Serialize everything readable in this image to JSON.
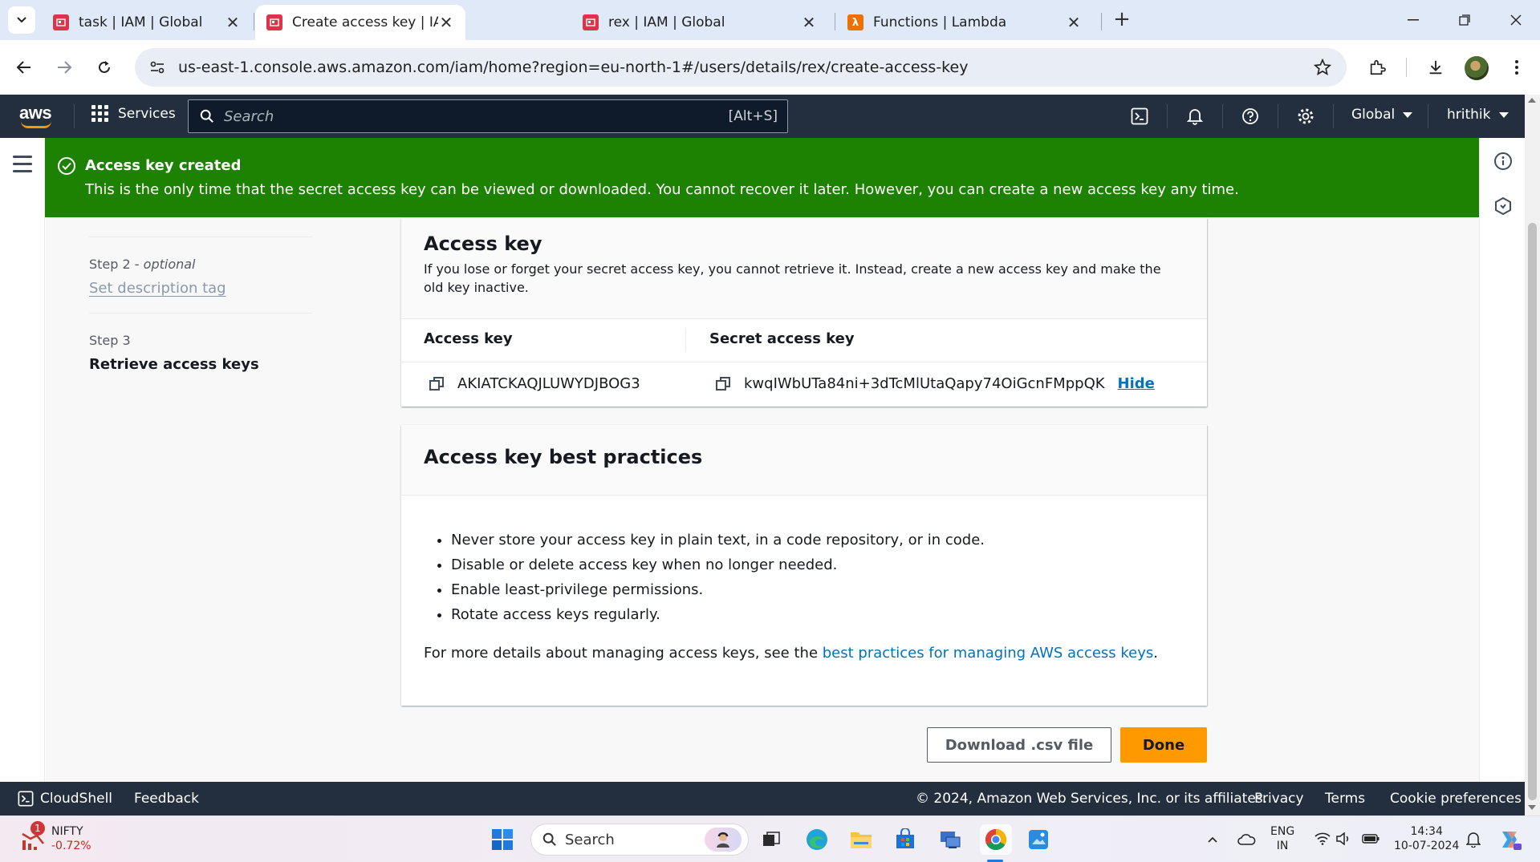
{
  "browser": {
    "tabs": [
      {
        "title": "task | IAM | Global",
        "active": false,
        "favicon": "iam"
      },
      {
        "title": "Create access key | IAM | Global",
        "active": true,
        "favicon": "iam"
      },
      {
        "title": "rex | IAM | Global",
        "active": false,
        "favicon": "iam"
      },
      {
        "title": "Functions | Lambda",
        "active": false,
        "favicon": "lambda"
      }
    ],
    "url": "us-east-1.console.aws.amazon.com/iam/home?region=eu-north-1#/users/details/rex/create-access-key"
  },
  "aws_nav": {
    "logo": "aws",
    "services_label": "Services",
    "search_placeholder": "Search",
    "search_shortcut": "[Alt+S]",
    "region": "Global",
    "user": "hrithik"
  },
  "flash": {
    "title": "Access key created",
    "message": "This is the only time that the secret access key can be viewed or downloaded. You cannot recover it later. However, you can create a new access key any time.",
    "color": "#1d8102"
  },
  "steps": {
    "step2_label": "Step 2",
    "step2_optional": "optional",
    "step2_title": "Set description tag",
    "step3_label": "Step 3",
    "step3_title": "Retrieve access keys"
  },
  "access_key_card": {
    "title": "Access key",
    "description": "If you lose or forget your secret access key, you cannot retrieve it. Instead, create a new access key and make the old key inactive.",
    "col_access_key": "Access key",
    "col_secret_key": "Secret access key",
    "access_key_value": "AKIATCKAQJLUWYDJBOG3",
    "secret_key_value": "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",
    "hide_label": "Hide"
  },
  "best_practices": {
    "title": "Access key best practices",
    "items": [
      "Never store your access key in plain text, in a code repository, or in code.",
      "Disable or delete access key when no longer needed.",
      "Enable least-privilege permissions.",
      "Rotate access keys regularly."
    ],
    "footer_prefix": "For more details about managing access keys, see the ",
    "footer_link": "best practices for managing AWS access keys",
    "footer_suffix": "."
  },
  "actions": {
    "download_label": "Download .csv file",
    "done_label": "Done",
    "primary_color": "#ff9900"
  },
  "aws_footer": {
    "cloudshell": "CloudShell",
    "feedback": "Feedback",
    "copyright": "© 2024, Amazon Web Services, Inc. or its affiliates.",
    "privacy": "Privacy",
    "terms": "Terms",
    "cookie": "Cookie preferences"
  },
  "taskbar": {
    "stock_name": "NIFTY",
    "stock_change": "-0.72%",
    "stock_badge": "1",
    "search_label": "Search",
    "lang_line1": "ENG",
    "lang_line2": "IN",
    "time": "14:34",
    "date": "10-07-2024"
  }
}
